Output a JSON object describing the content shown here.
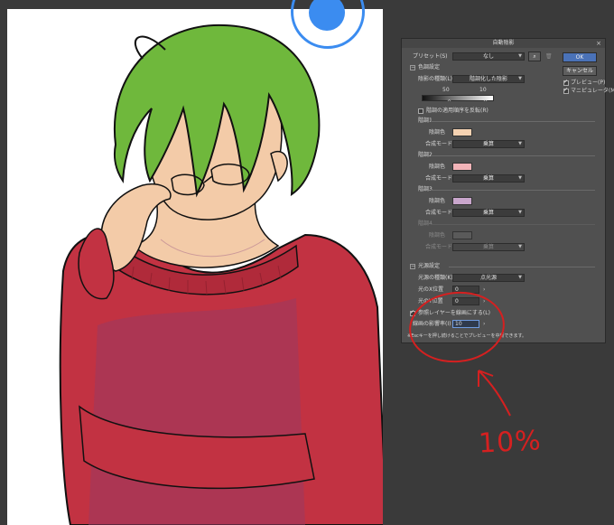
{
  "dialog": {
    "title": "自動陰影",
    "close": "×",
    "preset_label": "プリセット(S)",
    "preset_value": "なし",
    "ok": "OK",
    "cancel": "キャンセル",
    "preview_label": "プレビュー(P)",
    "mini_preview_label": "マニピュレータ(M)",
    "preview_checked": true,
    "mini_preview_checked": true,
    "shade_section": "色調設定",
    "shade_type_label": "陰影の種類(L)",
    "shade_type_value": "階調化した陰影",
    "grad_min": "50",
    "grad_max": "10",
    "reverse_label": "階調の適用順序を反転(R)",
    "tone1": {
      "header": "階調1",
      "color_label": "陰調色",
      "mode_label": "合成モード",
      "mode_value": "乗算",
      "color": "#f5d2b2"
    },
    "tone2": {
      "header": "階調2",
      "color_label": "陰調色",
      "mode_label": "合成モード",
      "mode_value": "乗算",
      "color": "#f2b4b8"
    },
    "tone3": {
      "header": "階調3",
      "color_label": "陰調色",
      "mode_label": "合成モード",
      "mode_value": "乗算",
      "color": "#c9a6cc"
    },
    "tone4": {
      "header": "階調4",
      "color_label": "陰調色",
      "mode_label": "合成モード",
      "mode_value": "乗算"
    },
    "light_section": "光源設定",
    "light_type_label": "光源の種類(K)",
    "light_type_value": "点光源",
    "light_x_label": "光のX位置",
    "light_x_value": "0",
    "light_y_label": "光のY位置",
    "light_y_value": "0",
    "ref_layer_label": "参照レイヤーを線画にする(L)",
    "line_influence_label": "線画の影響率(I)",
    "line_influence_value": "10",
    "hint": "※Escキーを押し続けることでプレビューを中断できます。"
  },
  "annotation": {
    "text": "10%",
    "color": "#d52020"
  },
  "cursor_color": "#3b8cf0"
}
